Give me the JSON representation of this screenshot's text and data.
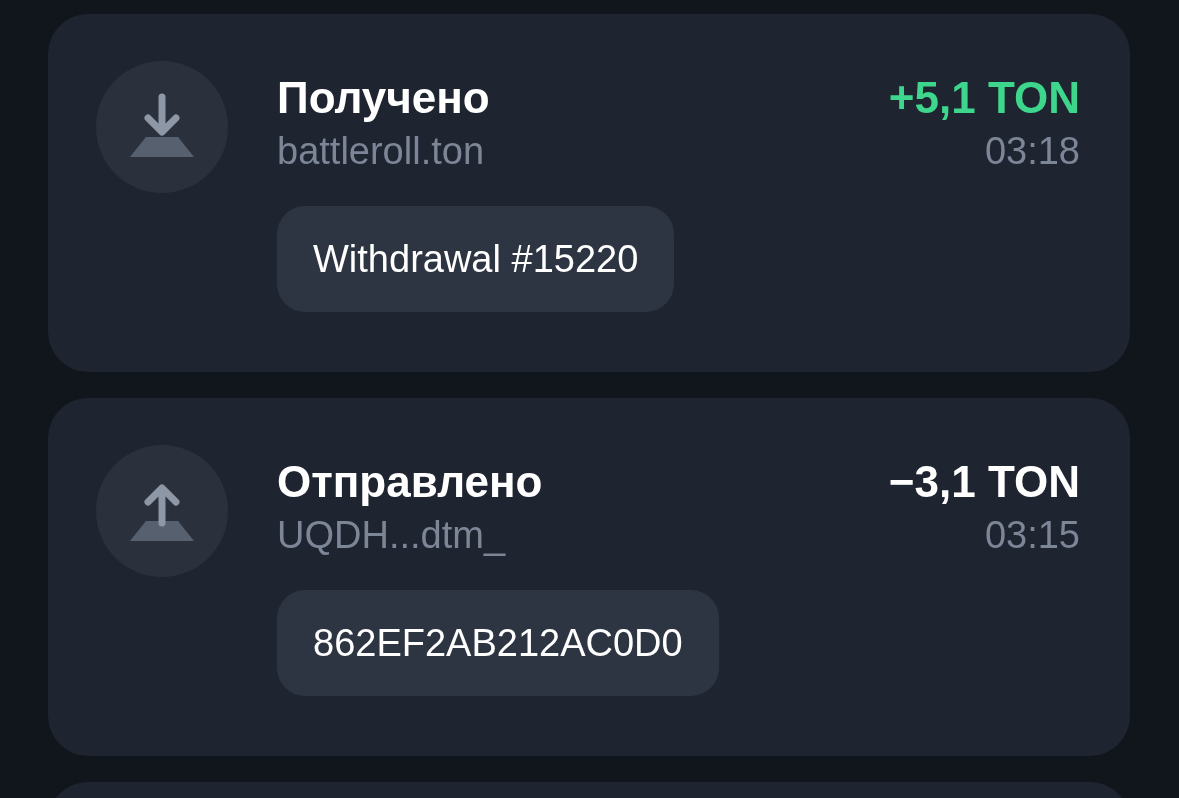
{
  "transactions": [
    {
      "kind": "in",
      "title": "Получено",
      "amount": "+5,1 TON",
      "counterparty": "battleroll.ton",
      "time": "03:18",
      "memo": "Withdrawal #15220"
    },
    {
      "kind": "out",
      "title": "Отправлено",
      "amount": "−3,1 TON",
      "counterparty": "UQDH...dtm_",
      "time": "03:15",
      "memo": "862EF2AB212AC0D0"
    },
    {
      "kind": "partial"
    }
  ]
}
